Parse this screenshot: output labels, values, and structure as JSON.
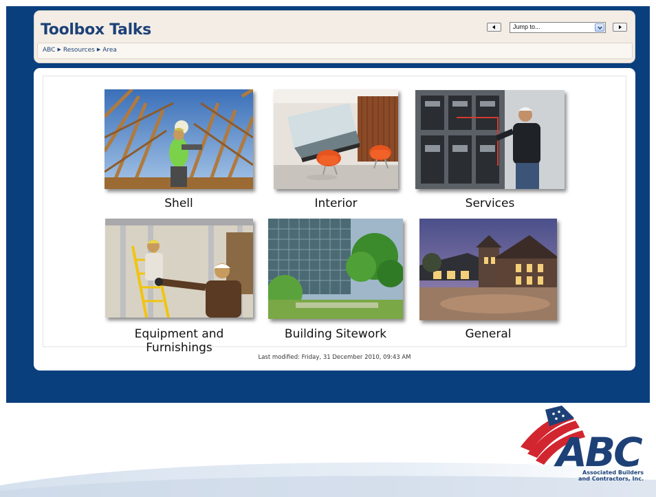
{
  "header": {
    "title": "Toolbox Talks",
    "breadcrumb": [
      "ABC",
      "Resources",
      "Area"
    ],
    "jump_to": {
      "selected": "Jump to..."
    }
  },
  "main": {
    "tiles": [
      {
        "label": "Shell"
      },
      {
        "label": "Interior"
      },
      {
        "label": "Services"
      },
      {
        "label": "Equipment and Furnishings"
      },
      {
        "label": "Building Sitework"
      },
      {
        "label": "General"
      }
    ],
    "last_modified": "Last modified: Friday, 31 December 2010, 09:43 AM"
  },
  "logo": {
    "text": "ABC",
    "tagline_line1": "Associated Builders",
    "tagline_line2": "and Contractors, Inc."
  },
  "colors": {
    "band_blue": "#0a3f7e",
    "title_blue": "#1d4177",
    "logo_red": "#d12630",
    "header_bg": "#f3ede6"
  },
  "icons": [
    "left-arrow-icon",
    "dropdown-arrow-icon",
    "right-arrow-icon"
  ]
}
